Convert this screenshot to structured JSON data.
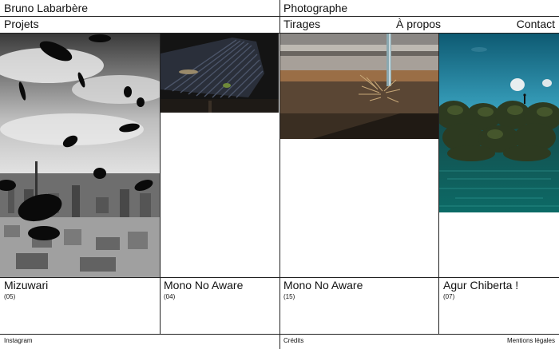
{
  "header": {
    "name": "Bruno Labarbère",
    "role": "Photographe"
  },
  "nav": {
    "projects": "Projets",
    "tirages": "Tirages",
    "apropos": "À propos",
    "contact": "Contact"
  },
  "cards": [
    {
      "title": "Mizuwari",
      "count": "(05)"
    },
    {
      "title": "Mono No Aware",
      "count": "(04)"
    },
    {
      "title": "Mono No Aware",
      "count": "(15)"
    },
    {
      "title": "Agur Chiberta !",
      "count": "(07)"
    }
  ],
  "footer": {
    "instagram": "Instagram",
    "credits": "Crédits",
    "legal": "Mentions légales"
  }
}
